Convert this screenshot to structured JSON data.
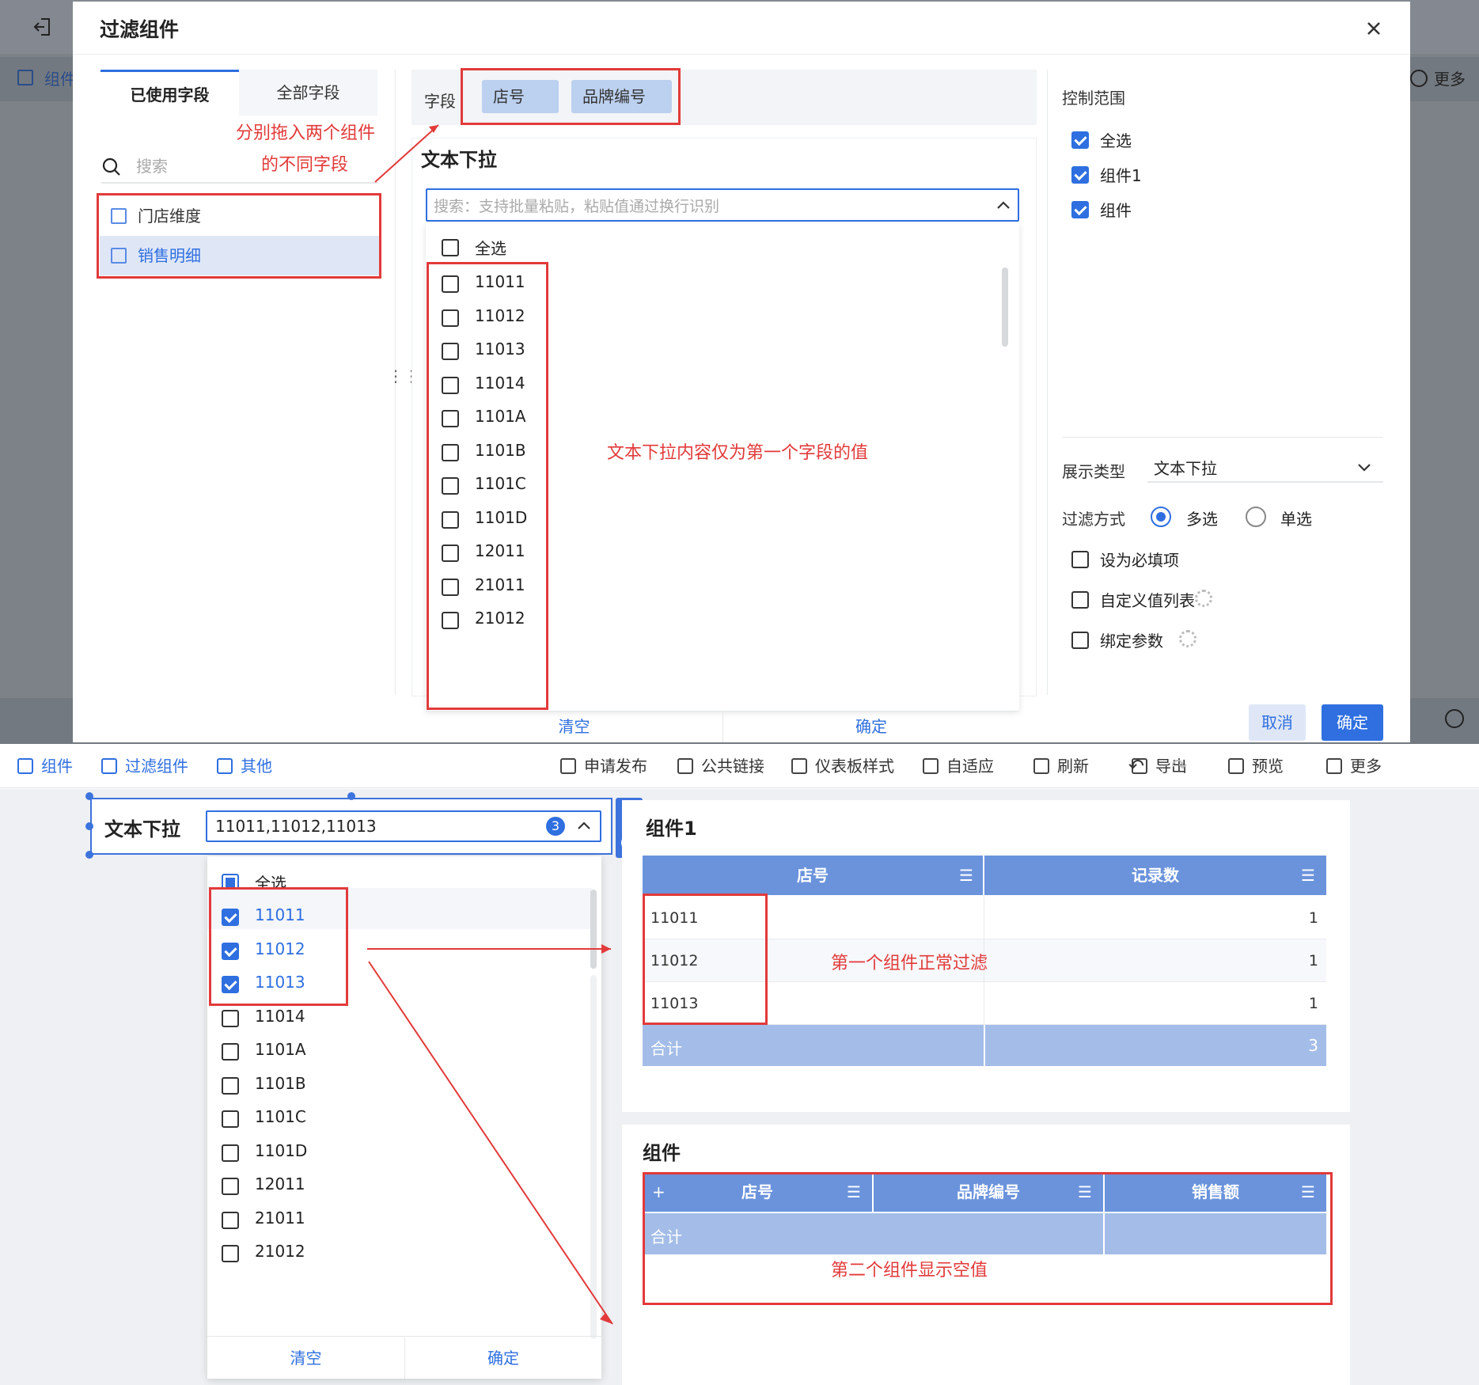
{
  "background_app": {
    "exit_icon": "exit-icon",
    "ghost_toolbar_left": "组件",
    "ghost_toolbar_right": "更多"
  },
  "modal": {
    "title": "过滤组件",
    "tabs": [
      "已使用字段",
      "全部字段"
    ],
    "search_placeholder": "搜索",
    "datasets": [
      "门店维度",
      "销售明细"
    ],
    "field_label": "字段",
    "field_chips": [
      "店号",
      "品牌编号"
    ],
    "widget_title": "文本下拉",
    "dropdown_placeholder": "搜索：支持批量粘贴，粘贴值通过换行识别",
    "select_all": "全选",
    "options": [
      "11011",
      "11012",
      "11013",
      "11014",
      "1101A",
      "1101B",
      "1101C",
      "1101D",
      "12011",
      "21011",
      "21012"
    ],
    "clear_label": "清空",
    "confirm_label": "确定",
    "control_range_title": "控制范围",
    "control_range": [
      {
        "label": "全选",
        "checked": true
      },
      {
        "label": "组件1",
        "checked": true
      },
      {
        "label": "组件",
        "checked": true
      }
    ],
    "display_type_label": "展示类型",
    "display_type_value": "文本下拉",
    "filter_mode_label": "过滤方式",
    "filter_modes": [
      {
        "label": "多选",
        "selected": true
      },
      {
        "label": "单选",
        "selected": false
      }
    ],
    "options_checkboxes": [
      {
        "label": "设为必填项",
        "has_gear": false
      },
      {
        "label": "自定义值列表",
        "has_gear": true
      },
      {
        "label": "绑定参数",
        "has_gear": true
      }
    ],
    "cancel_button": "取消",
    "ok_button": "确定"
  },
  "annotations": {
    "drag_note_line1": "分别拖入两个组件",
    "drag_note_line2": "的不同字段",
    "dropdown_note": "文本下拉内容仅为第一个字段的值",
    "first_widget_note": "第一个组件正常过滤",
    "second_widget_note": "第二个组件显示空值"
  },
  "toolbar": {
    "left": [
      "组件",
      "过滤组件",
      "其他"
    ],
    "right": [
      "申请发布",
      "公共链接",
      "仪表板样式",
      "自适应",
      "刷新",
      "导出",
      "预览",
      "更多"
    ]
  },
  "filter_widget": {
    "label": "文本下拉",
    "value": "11011,11012,11013",
    "count": "3",
    "select_all": "全选",
    "options": [
      {
        "label": "11011",
        "checked": true
      },
      {
        "label": "11012",
        "checked": true
      },
      {
        "label": "11013",
        "checked": true
      },
      {
        "label": "11014",
        "checked": false
      },
      {
        "label": "1101A",
        "checked": false
      },
      {
        "label": "1101B",
        "checked": false
      },
      {
        "label": "1101C",
        "checked": false
      },
      {
        "label": "1101D",
        "checked": false
      },
      {
        "label": "12011",
        "checked": false
      },
      {
        "label": "21011",
        "checked": false
      },
      {
        "label": "21012",
        "checked": false
      }
    ],
    "clear_label": "清空",
    "confirm_label": "确定"
  },
  "widget1": {
    "title": "组件1",
    "columns": [
      "店号",
      "记录数"
    ],
    "rows": [
      [
        "11011",
        "1"
      ],
      [
        "11012",
        "1"
      ],
      [
        "11013",
        "1"
      ]
    ],
    "total_label": "合计",
    "total_value": "3"
  },
  "widget2": {
    "title": "组件",
    "expand_symbol": "+",
    "columns": [
      "店号",
      "品牌编号",
      "销售额"
    ],
    "total_label": "合计"
  },
  "colors": {
    "accent": "#2f6fe0",
    "table_header": "#6b93dc",
    "table_total": "#a4bde8",
    "annotation_red": "#e23a3a",
    "chip": "#bcd0ef"
  }
}
